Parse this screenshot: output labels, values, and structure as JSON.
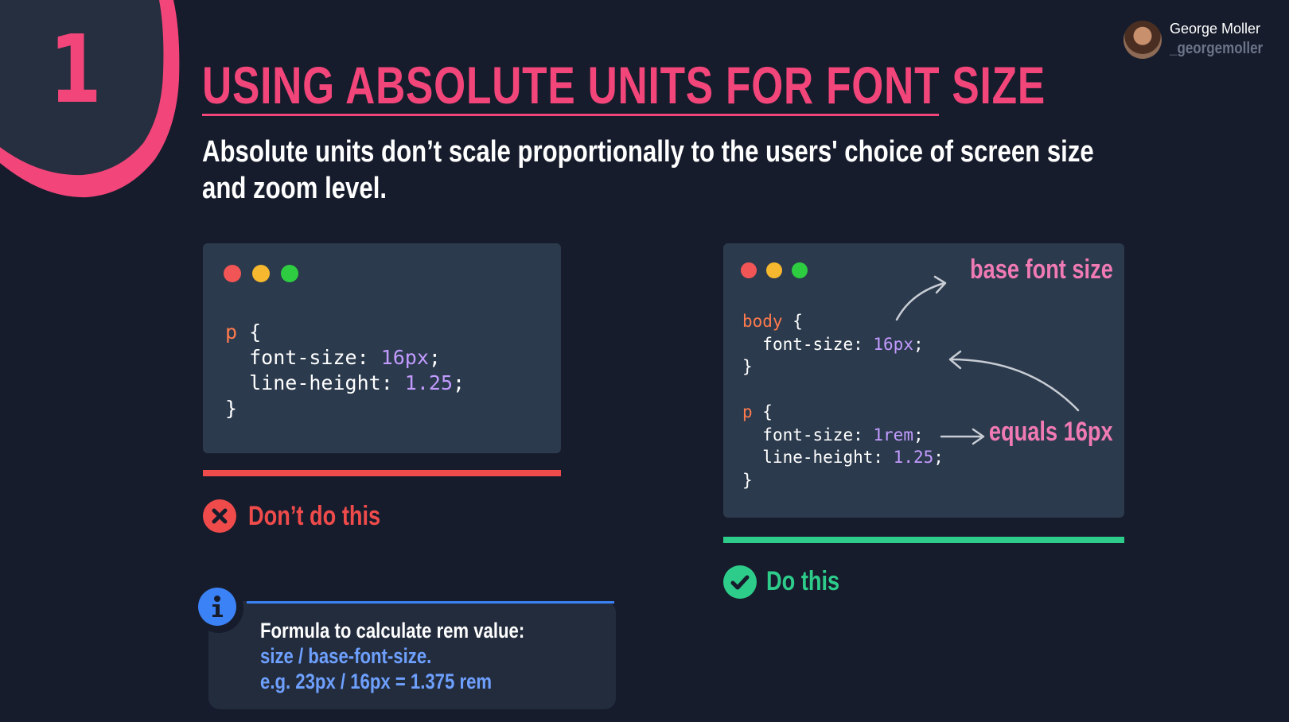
{
  "slide": {
    "number": "1",
    "title": "USING ABSOLUTE UNITS FOR FONT SIZE",
    "subtitle_line1": "Absolute units don’t scale proportionally to the users' choice of screen size",
    "subtitle_line2": "and zoom level."
  },
  "author": {
    "name": "George Moller",
    "handle": "_georgemoller"
  },
  "bad_example": {
    "code": {
      "selector": "p",
      "open": " {",
      "prop1": "font-size",
      "val1": "16px",
      "prop2": "line-height",
      "val2": "1.25",
      "close": "}"
    },
    "label": "Don’t do this"
  },
  "good_example": {
    "code": {
      "selector1": "body",
      "open1": " {",
      "prop1": "font-size",
      "val1": "16px",
      "close1": "}",
      "selector2": "p",
      "open2": " {",
      "prop2": "font-size",
      "val2": "1rem",
      "prop3": "line-height",
      "val3": "1.25",
      "close2": "}"
    },
    "annotation_base": "base font size",
    "annotation_equals": "equals 16px",
    "label": "Do this"
  },
  "info": {
    "line1": "Formula to calculate rem value:",
    "line2": "size / base-font-size.",
    "line3": "e.g. 23px / 16px = 1.375 rem"
  },
  "colors": {
    "background": "#161c2c",
    "accent_pink": "#f2457a",
    "bad_red": "#f04b4b",
    "good_green": "#2ecc8a",
    "info_blue": "#3b82f6",
    "note_pink": "#f07ab3"
  },
  "icons": {
    "bad": "x-circle-icon",
    "good": "check-circle-icon",
    "info": "info-circle-icon"
  }
}
